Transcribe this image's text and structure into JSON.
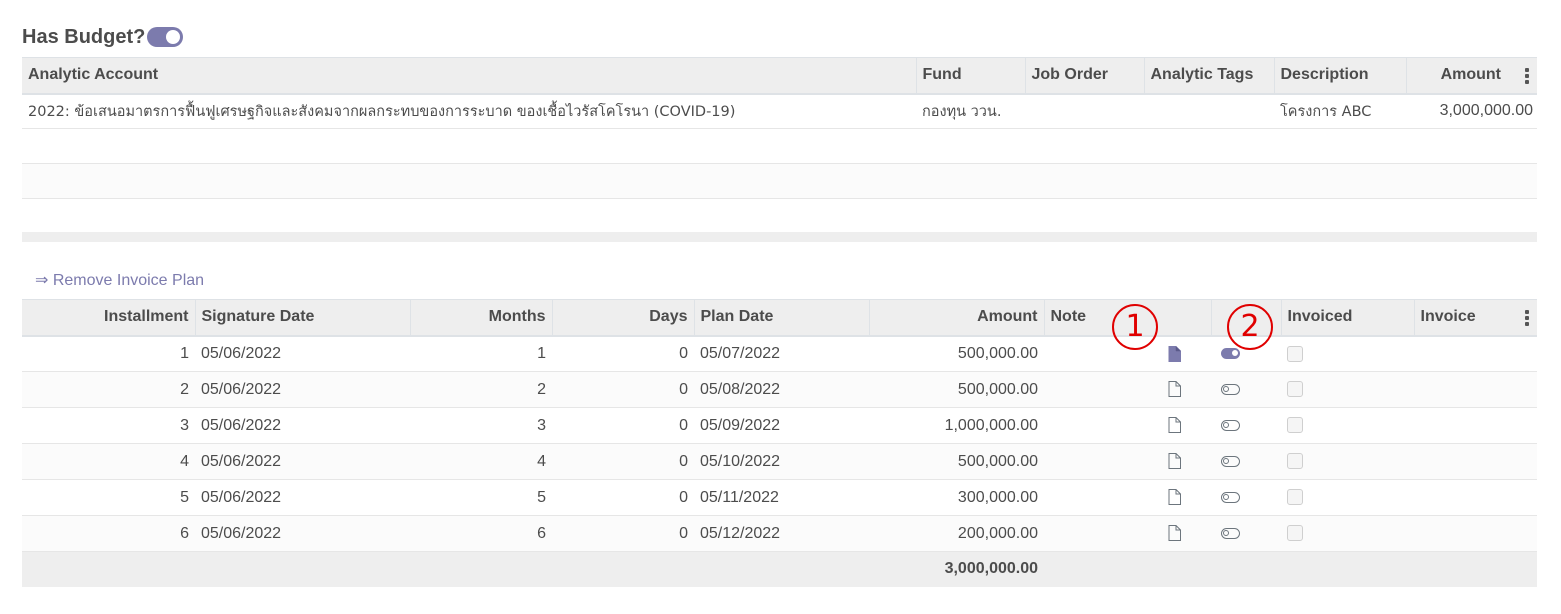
{
  "budget": {
    "label": "Has Budget?",
    "toggle_on": true
  },
  "budget_table": {
    "headers": [
      "Analytic Account",
      "Fund",
      "Job Order",
      "Analytic Tags",
      "Description",
      "Amount"
    ],
    "rows": [
      {
        "analytic_account": "2022: ข้อเสนอมาตรการฟื้นฟูเศรษฐกิจและสังคมจากผลกระทบของการระบาด ของเชื้อไวรัสโคโรนา (COVID-19)",
        "fund": "กองทุน ววน.",
        "job_order": "",
        "analytic_tags": "",
        "description": "โครงการ ABC",
        "amount": "3,000,000.00"
      }
    ]
  },
  "remove_link": "⇒ Remove Invoice Plan",
  "plan_table": {
    "headers": {
      "installment": "Installment",
      "signature_date": "Signature Date",
      "months": "Months",
      "days": "Days",
      "plan_date": "Plan Date",
      "amount": "Amount",
      "note": "Note",
      "invoiced": "Invoiced",
      "invoice": "Invoice"
    },
    "rows": [
      {
        "installment": "1",
        "signature_date": "05/06/2022",
        "months": "1",
        "days": "0",
        "plan_date": "05/07/2022",
        "amount": "500,000.00",
        "note_filled": true,
        "toggle_on": true
      },
      {
        "installment": "2",
        "signature_date": "05/06/2022",
        "months": "2",
        "days": "0",
        "plan_date": "05/08/2022",
        "amount": "500,000.00",
        "note_filled": false,
        "toggle_on": false
      },
      {
        "installment": "3",
        "signature_date": "05/06/2022",
        "months": "3",
        "days": "0",
        "plan_date": "05/09/2022",
        "amount": "1,000,000.00",
        "note_filled": false,
        "toggle_on": false
      },
      {
        "installment": "4",
        "signature_date": "05/06/2022",
        "months": "4",
        "days": "0",
        "plan_date": "05/10/2022",
        "amount": "500,000.00",
        "note_filled": false,
        "toggle_on": false
      },
      {
        "installment": "5",
        "signature_date": "05/06/2022",
        "months": "5",
        "days": "0",
        "plan_date": "05/11/2022",
        "amount": "300,000.00",
        "note_filled": false,
        "toggle_on": false
      },
      {
        "installment": "6",
        "signature_date": "05/06/2022",
        "months": "6",
        "days": "0",
        "plan_date": "05/12/2022",
        "amount": "200,000.00",
        "note_filled": false,
        "toggle_on": false
      }
    ],
    "total_amount": "3,000,000.00"
  },
  "annotations": [
    "1",
    "2"
  ],
  "icons": {
    "note": "document-icon",
    "toggle": "toggle-icon",
    "menu": "kebab-menu-icon"
  },
  "colors": {
    "accent": "#7c7bad",
    "marker": "#e00000",
    "header_bg": "#eeeeee"
  }
}
